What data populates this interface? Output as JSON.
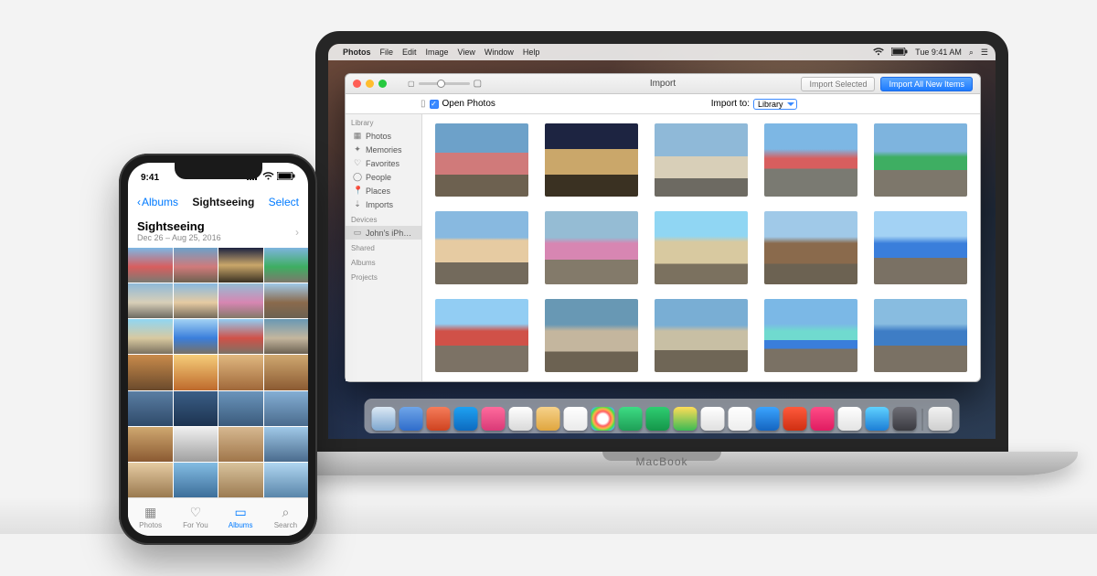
{
  "mac": {
    "label": "MacBook",
    "menubar": {
      "apple": "",
      "app": "Photos",
      "items": [
        "File",
        "Edit",
        "Image",
        "View",
        "Window",
        "Help"
      ],
      "clock": "Tue 9:41 AM"
    },
    "window": {
      "title": "Import",
      "btn_import_selected": "Import Selected",
      "btn_import_all": "Import All New Items",
      "open_photos_label": "Open Photos",
      "open_photos_checked": true,
      "import_to_label": "Import to:",
      "import_to_value": "Library",
      "sidebar": {
        "groups": [
          {
            "label": "Library",
            "items": [
              {
                "icon": "▦",
                "label": "Photos"
              },
              {
                "icon": "✦",
                "label": "Memories"
              },
              {
                "icon": "♡",
                "label": "Favorites"
              },
              {
                "icon": "◯",
                "label": "People"
              },
              {
                "icon": "📍",
                "label": "Places"
              },
              {
                "icon": "⇣",
                "label": "Imports"
              }
            ]
          },
          {
            "label": "Devices",
            "items": [
              {
                "icon": "▭",
                "label": "John's iPh…",
                "selected": true
              }
            ]
          },
          {
            "label": "Shared",
            "items": []
          },
          {
            "label": "Albums",
            "items": []
          },
          {
            "label": "Projects",
            "items": []
          }
        ]
      },
      "thumbs": [
        "linear-gradient(#6da1c9 40%, #d07a7a 40% 70%, #6d6150 70%)",
        "linear-gradient(#1d2441 35%, #caa76a 35% 70%, #3a3122 70%)",
        "linear-gradient(#8fb9d8 45%, #d8cfb8 45% 75%, #6d6a62 75%)",
        "linear-gradient(#7db7e4 35%, #d85e5e 48% 62%, #7a7a72 62%)",
        "linear-gradient(#7eb4de 38%, #3eae62 46% 64%, #7d776b 64%)",
        "linear-gradient(#88b9e0 36%, #e6cba2 40% 70%, #736a5c 70%)",
        "linear-gradient(#95bcd4 36%, #d786b2 44% 66%, #837a6a 66%)",
        "linear-gradient(#90d6f3 34%, #d8c9a0 42% 72%, #7b715f 72%)",
        "linear-gradient(#a0c9e8 35%, #8a6a4c 44% 72%, #6c6252 72%)",
        "linear-gradient(#a3d2f4 34%, #3a7edb 44% 64%, #7a7164 64%)",
        "linear-gradient(#92cdf3 34%, #d05148 44% 64%, #7c7265 64%)",
        "linear-gradient(#6898b4 35%, #c4b69e 44% 72%, #6c6252 72%)",
        "linear-gradient(#79aed4 36%, #c8bfa4 44% 70%, #6f6656 70%)",
        "linear-gradient(#7bb8e6 34%, #70dacf 44% 56%, #3a7edb 56% 68%, #7a7164 68%)",
        "linear-gradient(#88bce0 34%, #3e7dc5 44% 64%, #7a7164 64%)"
      ]
    },
    "dock_colors": [
      "linear-gradient(#dce9f5,#7da6cf)",
      "linear-gradient(#6fa5e8,#2f6dcb)",
      "linear-gradient(#f57c5a,#cf4320)",
      "linear-gradient(#1ea1f2,#0d6bbf)",
      "linear-gradient(#ff6b9d,#d93a77)",
      "linear-gradient(#fff,#d9d9d9)",
      "linear-gradient(#f6d28a,#e0a63f)",
      "linear-gradient(#fff,#eaeaea)",
      "radial-gradient(circle,#fff 30%,#ff5e62,#ffb347,#47e147,#47b0ff,#b047ff)",
      "linear-gradient(#3ddc84,#1f9f57)",
      "linear-gradient(#2ecd71,#15964a)",
      "linear-gradient(#ffdd57,#3cba54)",
      "linear-gradient(#fff,#e0e0e0)",
      "linear-gradient(#fff,#ededed)",
      "linear-gradient(#3aa4ff,#1565c0)",
      "linear-gradient(#ff5a3c,#cf2f12)",
      "linear-gradient(#ff4c87,#e01c61)",
      "linear-gradient(#ffffff,#e3e3e3)",
      "linear-gradient(#5fd1ff,#1c7ed6)",
      "linear-gradient(#6e6e76,#3a3a40)",
      "linear-gradient(#f2f2f2,#cfcfcf)"
    ]
  },
  "iphone": {
    "status_time": "9:41",
    "nav_back": "Albums",
    "nav_title": "Sightseeing",
    "nav_select": "Select",
    "album": {
      "name": "Sightseeing",
      "date_range": "Dec 26 – Aug 25, 2016"
    },
    "tabs": [
      {
        "label": "Photos",
        "glyph": "▦"
      },
      {
        "label": "For You",
        "glyph": "♡"
      },
      {
        "label": "Albums",
        "glyph": "▭",
        "selected": true
      },
      {
        "label": "Search",
        "glyph": "⌕"
      }
    ],
    "photo_tiles": [
      "linear-gradient(#7db7e4,#d85e5e 55%,#7a7a72)",
      "linear-gradient(#6da1c9,#d07a7a 55%,#6d6150)",
      "linear-gradient(#1d2441,#caa76a 50%,#3a3122)",
      "linear-gradient(#7eb4de,#3eae62 55%,#7d776b)",
      "linear-gradient(#8fb9d8,#d8cfb8 55%,#6d6a62)",
      "linear-gradient(#88b9e0,#e6cba2 55%,#736a5c)",
      "linear-gradient(#95bcd4,#d786b2 55%,#837a6a)",
      "linear-gradient(#a0c9e8,#8a6a4c 55%,#6c6252)",
      "linear-gradient(#90d6f3,#d8c9a0 55%,#7b715f)",
      "linear-gradient(#a3d2f4,#3a7edb 55%,#7a7164)",
      "linear-gradient(#92cdf3,#d05148 55%,#7c7265)",
      "linear-gradient(#6898b4,#c4b69e 55%,#6c6252)",
      "linear-gradient(#c98b4b,#6a4a2c)",
      "linear-gradient(#f6cd7a,#be6a2c)",
      "linear-gradient(#e0b880,#a0683a)",
      "linear-gradient(#cfa870,#8b5a32)",
      "linear-gradient(#5a7ea3,#2f4a6a)",
      "linear-gradient(#3b5e86,#1c3350)",
      "linear-gradient(#6a94bb,#3b5b7c)",
      "linear-gradient(#84aed4,#4a6b8d)",
      "linear-gradient(#cfa870,#8b5a32)",
      "linear-gradient(#f0f0f0,#a0a0a0)",
      "linear-gradient(#d6b890,#a0764a)",
      "linear-gradient(#a0c9e8,#4a6b8d)",
      "linear-gradient(#e6cba2,#9a7a50)",
      "linear-gradient(#83bce3,#3d6f9a)",
      "linear-gradient(#d9c39c,#9c7b52)",
      "linear-gradient(#b0d6f1,#5a86aa)"
    ]
  }
}
